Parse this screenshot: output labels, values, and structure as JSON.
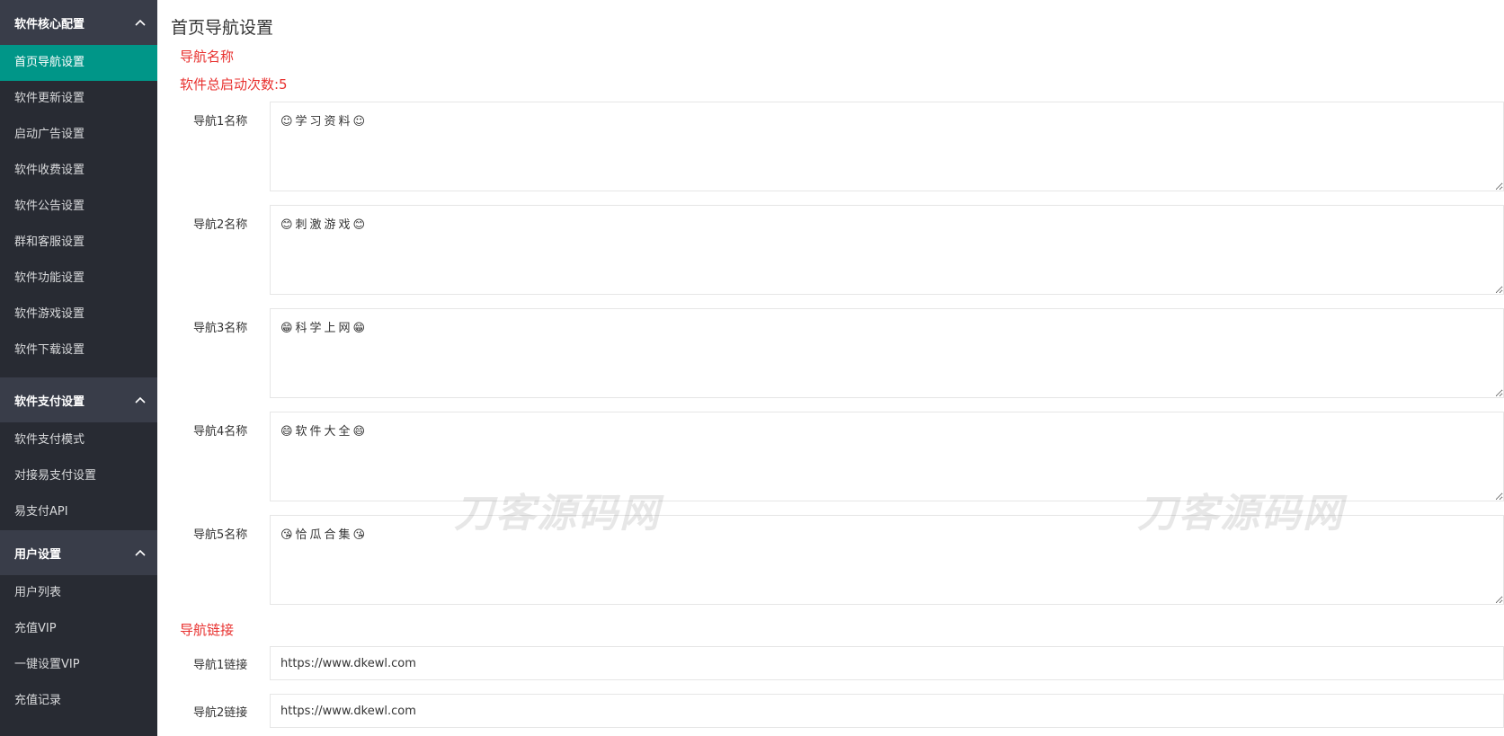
{
  "sidebar": {
    "groups": [
      {
        "title": "软件核心配置",
        "items": [
          "首页导航设置",
          "软件更新设置",
          "启动广告设置",
          "软件收费设置",
          "软件公告设置",
          "群和客服设置",
          "软件功能设置",
          "软件游戏设置",
          "软件下载设置"
        ]
      },
      {
        "title": "软件支付设置",
        "items": [
          "软件支付模式",
          "对接易支付设置",
          "易支付API"
        ]
      },
      {
        "title": "用户设置",
        "items": [
          "用户列表",
          "充值VIP",
          "一键设置VIP",
          "充值记录"
        ]
      }
    ],
    "active_item": "首页导航设置",
    "active_color": "#009688"
  },
  "main": {
    "page_title": "首页导航设置",
    "nav_name_section": "导航名称",
    "launch_count": "软件总启动次数:5",
    "nav_names": [
      {
        "label": "导航1名称",
        "value": "☺学习资料☺"
      },
      {
        "label": "导航2名称",
        "value": "😊刺激游戏😊"
      },
      {
        "label": "导航3名称",
        "value": "😁科学上网😁"
      },
      {
        "label": "导航4名称",
        "value": "😄软件大全😄"
      },
      {
        "label": "导航5名称",
        "value": "😘恰瓜合集😘"
      }
    ],
    "nav_link_section": "导航链接",
    "nav_links": [
      {
        "label": "导航1链接",
        "value": "https://www.dkewl.com"
      },
      {
        "label": "导航2链接",
        "value": "https://www.dkewl.com"
      }
    ],
    "accent_red": "#e8312f"
  },
  "watermark": "刀客源码网"
}
